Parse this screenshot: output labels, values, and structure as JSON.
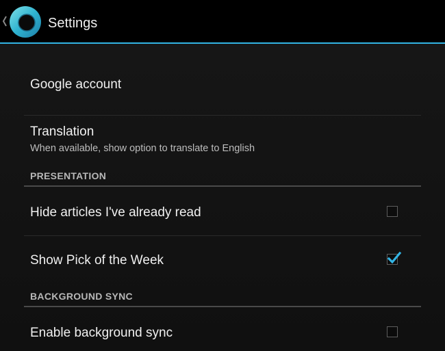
{
  "action_bar": {
    "title": "Settings",
    "accent_color": "#33b5e5",
    "up_icon": "chevron-left-icon",
    "logo_icon": "ring-logo-icon"
  },
  "preferences": {
    "google_account": {
      "title": "Google account"
    },
    "translation": {
      "title": "Translation",
      "summary": "When available, show option to translate to English"
    },
    "presentation_header": "PRESENTATION",
    "hide_read": {
      "title": "Hide articles I've already read",
      "checked": false
    },
    "pick_of_week": {
      "title": "Show Pick of the Week",
      "checked": true
    },
    "background_sync_header": "BACKGROUND SYNC",
    "enable_sync": {
      "title": "Enable background sync",
      "checked": false
    }
  }
}
